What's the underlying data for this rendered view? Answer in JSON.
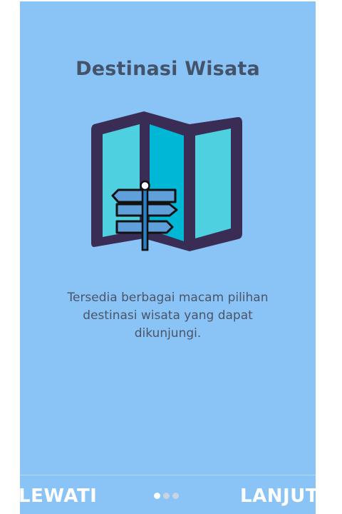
{
  "onboarding": {
    "title": "Destinasi Wisata",
    "description": "Tersedia berbagai macam pilihan destinasi wisata yang dapat dikunjungi.",
    "illustration_icon": "map-signpost-icon",
    "background_color": "#8ac3f5",
    "title_color": "#43536a"
  },
  "footer": {
    "skip_label": "LEWATI",
    "next_label": "LANJUT",
    "pagination": {
      "total_pages": 3,
      "current_page": 1
    }
  }
}
